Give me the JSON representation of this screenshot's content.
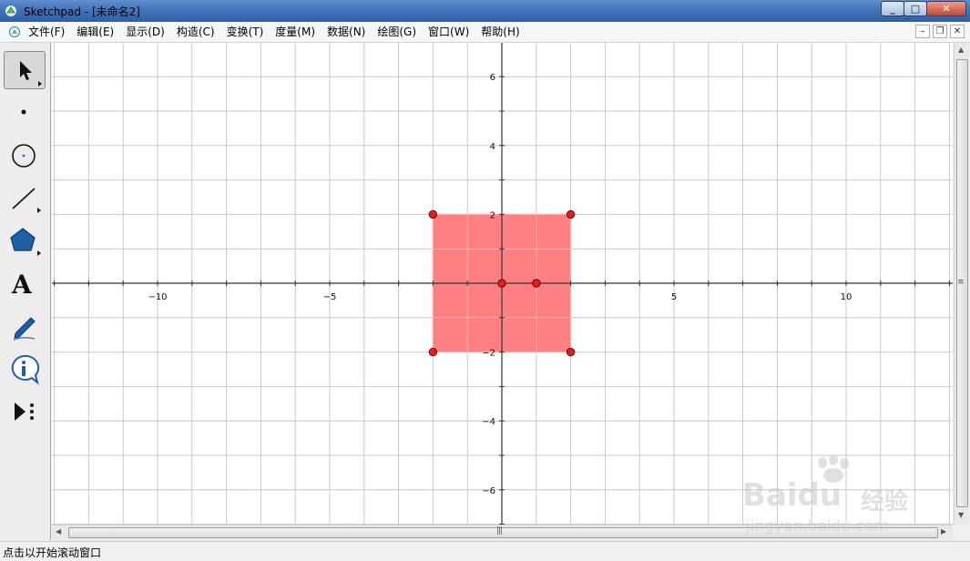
{
  "window": {
    "title": "Sketchpad  - [未命名2]",
    "buttons": {
      "minimize": "_",
      "maximize": "□",
      "close": "✕"
    }
  },
  "menu": {
    "items": [
      "文件(F)",
      "编辑(E)",
      "显示(D)",
      "构造(C)",
      "变换(T)",
      "度量(M)",
      "数据(N)",
      "绘图(G)",
      "窗口(W)",
      "帮助(H)"
    ],
    "mdi_buttons": {
      "minimize": "–",
      "restore": "❐",
      "close": "✕"
    }
  },
  "toolbox": {
    "tools": [
      "arrow-select-tool",
      "point-tool",
      "compass-tool",
      "straightedge-tool",
      "polygon-tool",
      "text-tool",
      "marker-tool",
      "information-tool",
      "custom-tool"
    ],
    "text_tool_glyph": "A",
    "selected_tool": "arrow-select-tool"
  },
  "graph": {
    "x_range": [
      -13,
      13
    ],
    "y_range": [
      -7,
      7
    ],
    "grid": true,
    "x_tick_labels": [
      "−10",
      "−5",
      "5",
      "10"
    ],
    "y_tick_labels": [
      "6",
      "4",
      "2",
      "−2",
      "−4",
      "−6"
    ],
    "polygon": {
      "vertices": [
        [
          -2,
          2
        ],
        [
          2,
          2
        ],
        [
          2,
          -2
        ],
        [
          -2,
          -2
        ]
      ],
      "fill_color": "#ff8080"
    },
    "points": [
      [
        -2,
        2
      ],
      [
        2,
        2
      ],
      [
        2,
        -2
      ],
      [
        -2,
        -2
      ],
      [
        0,
        0
      ],
      [
        1,
        0
      ]
    ],
    "point_color": "#e02020"
  },
  "statusbar": {
    "text": "点击以开始滚动窗口"
  },
  "watermark": {
    "brand": "Baidu",
    "brand_cn": "经验",
    "url": "jingyan.baidu.com"
  }
}
